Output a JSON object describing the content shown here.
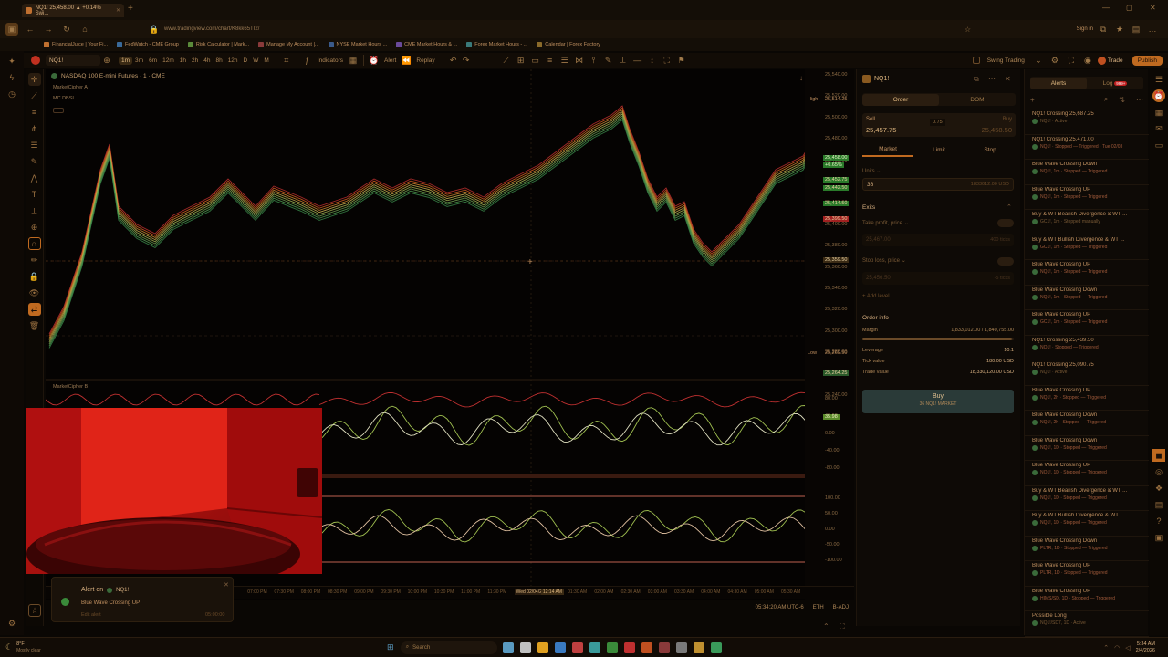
{
  "browser": {
    "tab_title": "NQ1! 25,458.00 ▲ +0.14% Swi...",
    "url": "www.tradingview.com/chart/K8kk65TI2/",
    "sign_in": "Sign in",
    "bookmarks": [
      "FinancialJuice | Your Fi...",
      "FedWatch - CME Group",
      "Risk Calculator | Mark...",
      "Manage My Account |...",
      "NYSE Market Hours ...",
      "CME Market Hours & ...",
      "Forex Market Hours - ...",
      "Calendar | Forex Factory"
    ]
  },
  "toolbar": {
    "symbol": "NQ1!",
    "intervals": [
      "1m",
      "3m",
      "6m",
      "12m",
      "1h",
      "2h",
      "4h",
      "8h",
      "12h",
      "D",
      "W",
      "M"
    ],
    "active_interval": "1m",
    "indicators": "Indicators",
    "alert": "Alert",
    "replay": "Replay",
    "layout_name": "Swing Trading",
    "trade": "Trade",
    "publish": "Publish"
  },
  "chart": {
    "title": "NASDAQ 100 E-mini Futures · 1 · CME",
    "indicator1": "MarketCipher A",
    "indicator2": "MC DBSI",
    "indicator3": "MarketCipher B",
    "price_axis": [
      "25,540.00",
      "25,520.00",
      "25,500.00",
      "25,480.00",
      "25,460.00",
      "25,440.00",
      "25,420.00",
      "25,400.00",
      "25,380.00",
      "25,360.00",
      "25,340.00",
      "25,320.00",
      "25,300.00",
      "25,280.00",
      "25,260.00",
      "25,240.00"
    ],
    "high_label": "High",
    "high_value": "25,514.25",
    "low_label": "Low",
    "low_value": "25,269.50",
    "current_price": "25,458.00",
    "current_change": "+0.65%",
    "price_tags": [
      "25,452.75",
      "25,442.50",
      "25,414.50",
      "25,399.50",
      "25,359.50",
      "25,264.25"
    ],
    "osc1_axis": [
      "80.00",
      "40.00",
      "0.00",
      "-40.00",
      "-80.00"
    ],
    "osc1_tag": "35.98",
    "osc2_axis": [
      "100.00",
      "50.00",
      "0.00",
      "-50.00",
      "-100.00"
    ],
    "time_axis": [
      "PM",
      "07:00 PM",
      "07:30 PM",
      "08:00 PM",
      "08:30 PM",
      "09:00 PM",
      "09:30 PM",
      "10:00 PM",
      "10:30 PM",
      "11:00 PM",
      "11:30 PM",
      "Wed 02/04/2026",
      "12:14 AM",
      "01:30 AM",
      "02:00 AM",
      "02:30 AM",
      "03:00 AM",
      "03:30 AM",
      "04:00 AM",
      "04:30 AM",
      "05:00 AM",
      "05:30 AM"
    ],
    "clock": "05:34:20 AM UTC-6",
    "session": "ETH",
    "adj": "B-ADJ"
  },
  "toast": {
    "title": "Alert on",
    "symbol": "NQ1!",
    "message": "Blue Wave Crossing UP",
    "edit": "Edit alert",
    "time": "05:00:00"
  },
  "order_panel": {
    "symbol": "NQ1!",
    "tab_order": "Order",
    "tab_dom": "DOM",
    "sell_label": "Sell",
    "sell_price": "25,457.75",
    "spread": "0.75",
    "buy_label": "Buy",
    "buy_price": "25,458.50",
    "type_market": "Market",
    "type_limit": "Limit",
    "type_stop": "Stop",
    "units_label": "Units",
    "units_value": "36",
    "units_usd": "1833012.00 USD",
    "exits": "Exits",
    "take_profit": "Take profit, price",
    "tp_value": "25,467.00",
    "tp_ticks": "400 ticks",
    "stop_loss": "Stop loss, price",
    "sl_value": "25,456.50",
    "sl_ticks": "-5 ticks",
    "add_level": "+ Add level",
    "order_info": "Order info",
    "margin_label": "Margin",
    "margin_value": "1,833,012.00 / 1,840,755.00",
    "leverage_label": "Leverage",
    "leverage_value": "10:1",
    "tick_label": "Tick value",
    "tick_value": "180.00 USD",
    "trade_label": "Trade value",
    "trade_value": "18,330,120.00 USD",
    "buy_button": "Buy",
    "buy_sub": "36 NQ1! MARKET"
  },
  "alerts_panel": {
    "tab_alerts": "Alerts",
    "tab_log": "Log",
    "log_badge": "999+",
    "items": [
      {
        "title": "NQ1! Crossing 25,687.25",
        "sub": "NQ1! · Active"
      },
      {
        "title": "NQ1! Crossing 25,471.00",
        "sub": "NQ1! · Stopped — Triggered · Tue 02/03"
      },
      {
        "title": "Blue Wave Crossing Down",
        "sub": "NQ1!, 1m · Stopped — Triggered"
      },
      {
        "title": "Blue Wave Crossing UP",
        "sub": "NQ1!, 1m · Stopped — Triggered"
      },
      {
        "title": "Buy & WT Bearish Divergence & WT ...",
        "sub": "GC1!, 1m · Stopped manually"
      },
      {
        "title": "Buy & WT Bullish Divergence & WT ...",
        "sub": "GC1!, 1m · Stopped — Triggered"
      },
      {
        "title": "Blue Wave Crossing UP",
        "sub": "NQ1!, 1m · Stopped — Triggered"
      },
      {
        "title": "Blue Wave Crossing Down",
        "sub": "NQ1!, 1m · Stopped — Triggered"
      },
      {
        "title": "Blue Wave Crossing UP",
        "sub": "GC1!, 1m · Stopped — Triggered"
      },
      {
        "title": "NQ1! Crossing 25,439.50",
        "sub": "NQ1! · Stopped — Triggered"
      },
      {
        "title": "NQ1! Crossing 25,090.75",
        "sub": "NQ1! · Active"
      },
      {
        "title": "Blue Wave Crossing UP",
        "sub": "NQ1!, 2h · Stopped — Triggered"
      },
      {
        "title": "Blue Wave Crossing Down",
        "sub": "NQ1!, 2h · Stopped — Triggered"
      },
      {
        "title": "Blue Wave Crossing Down",
        "sub": "NQ1!, 1D · Stopped — Triggered"
      },
      {
        "title": "Blue Wave Crossing UP",
        "sub": "NQ1!, 1D · Stopped — Triggered"
      },
      {
        "title": "Buy & WT Bearish Divergence & WT ...",
        "sub": "NQ1!, 1D · Stopped — Triggered"
      },
      {
        "title": "Buy & WT Bullish Divergence & WT ...",
        "sub": "NQ1!, 1D · Stopped — Triggered"
      },
      {
        "title": "Blue Wave Crossing Down",
        "sub": "PLTR, 1D · Stopped — Triggered"
      },
      {
        "title": "Blue Wave Crossing UP",
        "sub": "PLTR, 1D · Stopped — Triggered"
      },
      {
        "title": "Blue Wave Crossing UP",
        "sub": "HIMS/SD, 1D · Stopped — Triggered"
      },
      {
        "title": "Possible Long",
        "sub": "NQ1!/SD7, 1D · Active"
      }
    ]
  },
  "taskbar": {
    "weather_temp": "8°F",
    "weather_desc": "Mostly clear",
    "search": "Search",
    "time": "5:34 AM",
    "date": "2/4/2026"
  }
}
